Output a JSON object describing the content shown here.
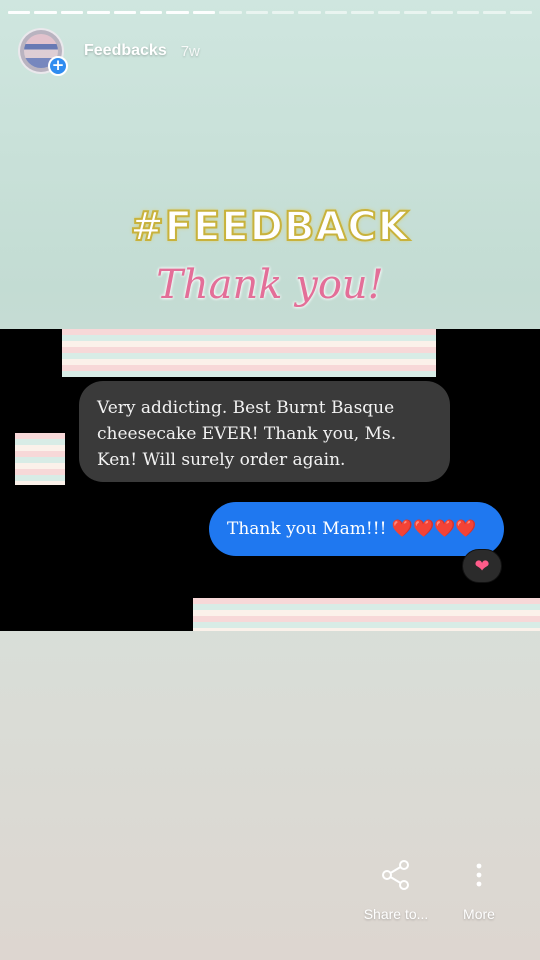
{
  "story": {
    "username": "Feedbacks",
    "time": "7w",
    "progress_segments": 20,
    "current_segment": 8
  },
  "content": {
    "hashtag": "#FEEDBACK",
    "thanks": "Thank you!",
    "message_in": "Very addicting. Best Burnt Basque cheesecake EVER! Thank you, Ms. Ken! Will surely order again.",
    "message_out": "Thank you Mam!!! ❤️❤️❤️❤️",
    "reaction": "❤"
  },
  "actions": {
    "share_label": "Share to...",
    "more_label": "More"
  },
  "colors": {
    "accent_blue": "#1f78f0",
    "title_pink": "#e36f98",
    "title_gold": "#c8b23c"
  },
  "icons": [
    "share-icon",
    "more-vertical-icon",
    "add-icon"
  ]
}
